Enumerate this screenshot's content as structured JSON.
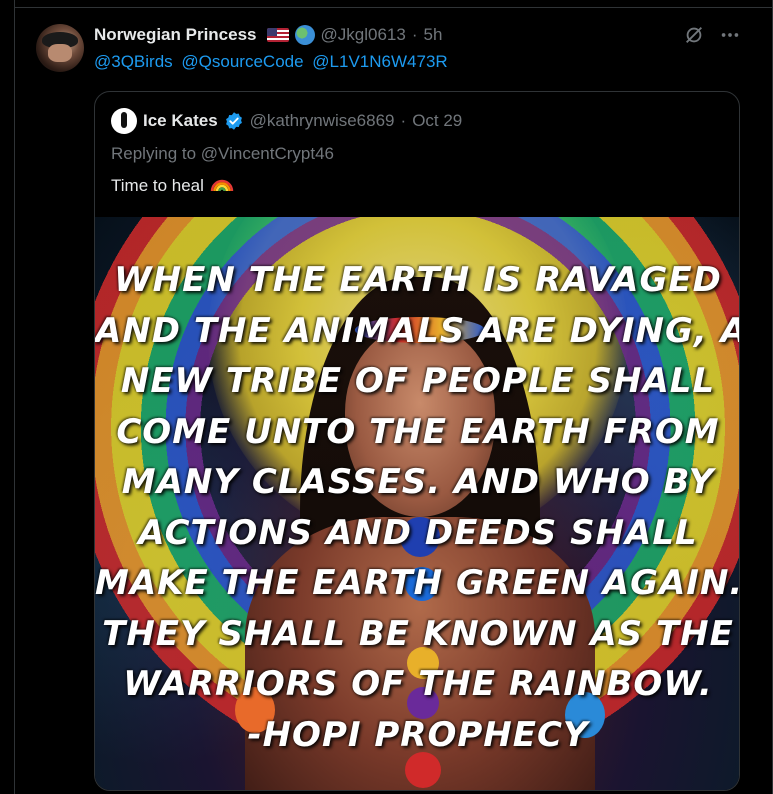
{
  "colors": {
    "background": "#000000",
    "text": "#e7e9ea",
    "muted": "#71767b",
    "link": "#1d9bf0",
    "border": "#2f3336"
  },
  "tweet": {
    "author_name": "Norwegian Princess",
    "flag_icon": "us-flag-emoji",
    "globe_icon": "globe-emoji",
    "handle": "@Jkgl0613",
    "separator": "·",
    "time": "5h",
    "mentions": [
      "@3QBirds",
      "@QsourceCode",
      "@L1V1N6W473R"
    ],
    "action_icons": [
      "grok-icon",
      "more-icon"
    ]
  },
  "quoted": {
    "author_name": "Ice Kates",
    "verified_icon": "verified-badge-icon",
    "handle": "@kathrynwise6869",
    "separator": "·",
    "date": "Oct 29",
    "reply_prefix": "Replying to",
    "reply_handle": "@VincentCrypt46",
    "text": "Time to heal",
    "text_emoji": "rainbow-emoji",
    "image_text_lines": [
      "WHEN THE EARTH IS RAVAGED",
      "AND THE ANIMALS ARE DYING, A",
      "NEW TRIBE OF PEOPLE SHALL",
      "COME UNTO THE EARTH FROM",
      "MANY CLASSES. AND WHO BY",
      "ACTIONS AND DEEDS SHALL",
      "MAKE THE EARTH GREEN AGAIN.",
      "THEY SHALL BE KNOWN AS THE",
      "WARRIORS OF THE RAINBOW.",
      "-HOPI PROPHECY"
    ]
  }
}
